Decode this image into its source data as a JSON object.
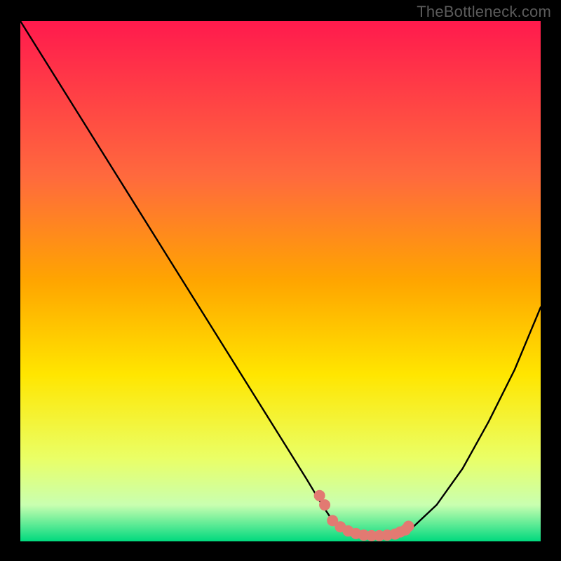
{
  "watermark": "TheBottleneck.com",
  "colors": {
    "background": "#000000",
    "watermark_text": "#5b5b5b",
    "curve": "#000000",
    "dot_fill": "#e27a72",
    "dot_stroke": "#e27a72",
    "gradient_top": "#ff1a4d",
    "gradient_mid1": "#ffa500",
    "gradient_mid2": "#ffe600",
    "gradient_mid3": "#eaff66",
    "gradient_bottom": "#00d97e"
  },
  "chart_data": {
    "type": "line",
    "title": "",
    "xlabel": "",
    "ylabel": "",
    "xlim": [
      0,
      100
    ],
    "ylim": [
      0,
      100
    ],
    "series": [
      {
        "name": "bottleneck-curve",
        "x": [
          0,
          5,
          10,
          15,
          20,
          25,
          30,
          35,
          40,
          45,
          50,
          55,
          58,
          60,
          62,
          64,
          66,
          68,
          70,
          72,
          75,
          80,
          85,
          90,
          95,
          100
        ],
        "y": [
          100,
          92,
          84,
          76,
          68,
          60,
          52,
          44,
          36,
          28,
          20,
          12,
          7,
          4,
          2.5,
          1.5,
          1,
          1,
          1,
          1.3,
          2.3,
          7,
          14,
          23,
          33,
          45
        ]
      }
    ],
    "highlight_points": {
      "x": [
        57.5,
        58.5,
        60,
        61.5,
        63,
        64.5,
        66,
        67.5,
        69,
        70.5,
        72,
        73,
        74,
        74.6
      ],
      "y": [
        8.8,
        7.0,
        4.0,
        2.8,
        2.0,
        1.5,
        1.2,
        1.1,
        1.1,
        1.2,
        1.4,
        1.8,
        2.2,
        2.9
      ]
    }
  }
}
